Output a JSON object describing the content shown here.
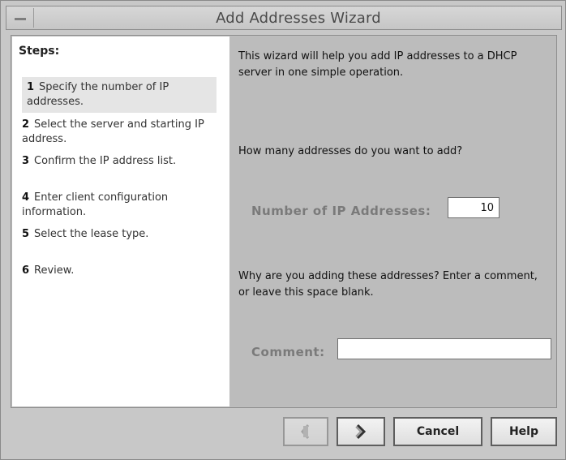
{
  "window": {
    "title": "Add Addresses Wizard",
    "menu_icon": "window-menu-icon"
  },
  "steps_panel": {
    "title": "Steps:",
    "items": [
      {
        "num": "1",
        "label": "Specify the number of IP addresses."
      },
      {
        "num": "2",
        "label": "Select the server and starting IP address."
      },
      {
        "num": "3",
        "label": "Confirm the IP address list."
      },
      {
        "num": "4",
        "label": "Enter client configuration information."
      },
      {
        "num": "5",
        "label": "Select the lease type."
      },
      {
        "num": "6",
        "label": "Review."
      }
    ]
  },
  "main": {
    "intro": "This wizard will help you add IP addresses to a DHCP server in one simple operation.",
    "question": "How many addresses do you want to add?",
    "number_label": "Number of IP Addresses:",
    "number_value": "10",
    "comment_prompt": "Why are you adding these addresses? Enter a comment, or leave this space blank.",
    "comment_label": "Comment:",
    "comment_value": ""
  },
  "buttons": {
    "back_icon": "back-arrow-icon",
    "next_icon": "next-arrow-icon",
    "cancel": "Cancel",
    "help": "Help"
  },
  "colors": {
    "panel": "#bdbdbd",
    "steps_bg": "#ffffff",
    "active_step_bg": "#e5e5e5",
    "disabled_text": "#7a7a7a"
  }
}
